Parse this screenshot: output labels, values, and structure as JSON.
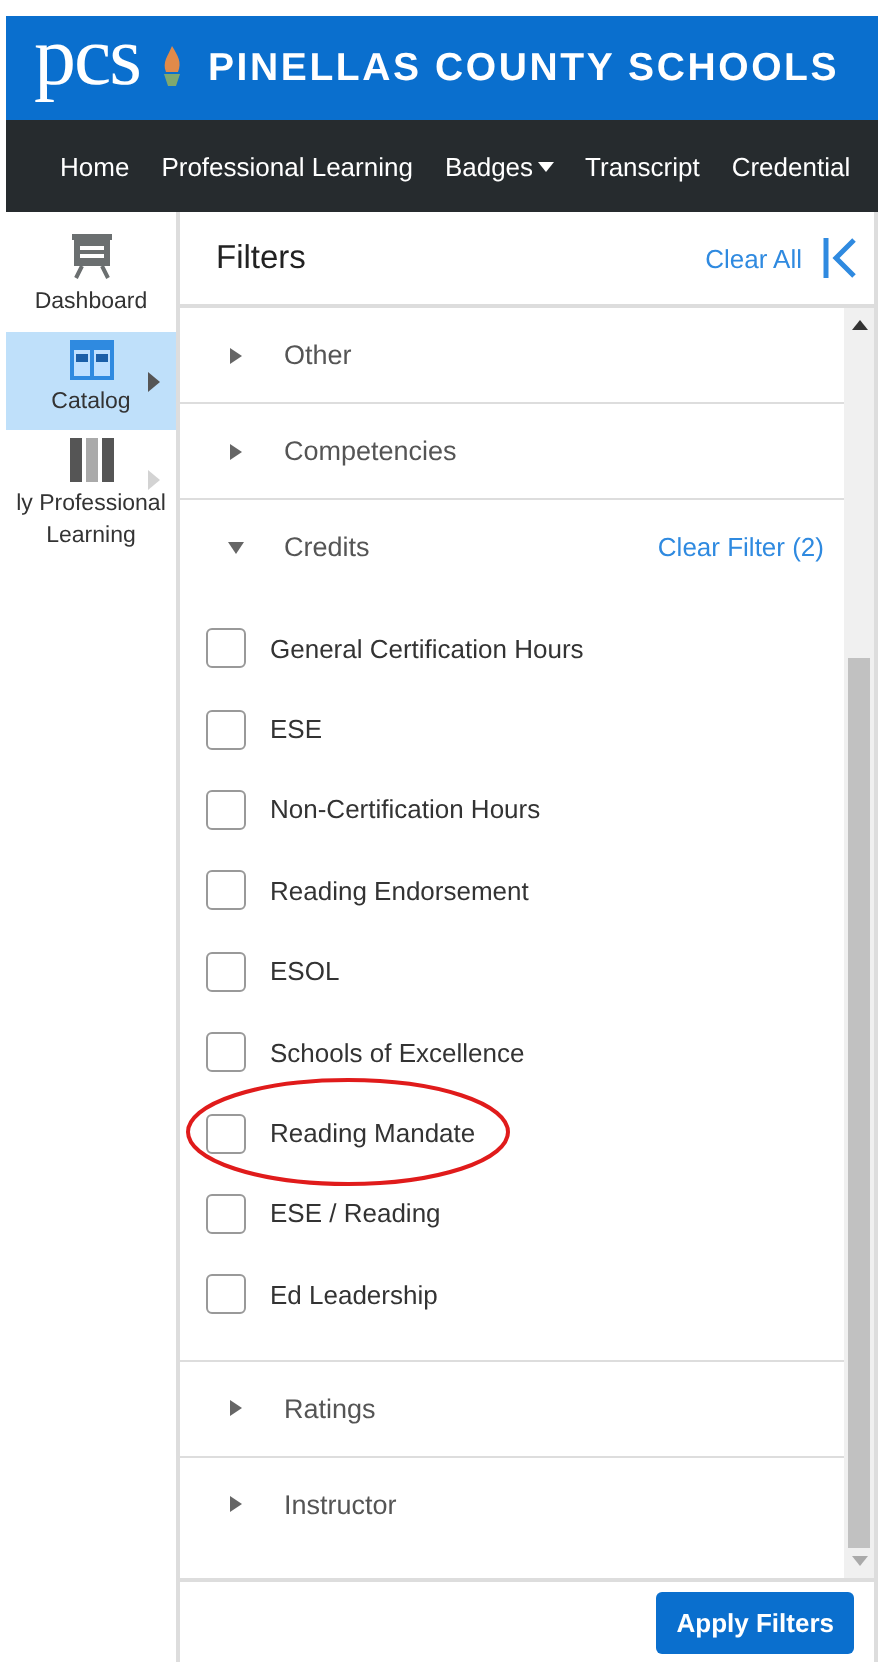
{
  "brand": {
    "logo": "pcs",
    "name": "PINELLAS COUNTY SCHOOLS"
  },
  "nav": [
    {
      "label": "Home",
      "dropdown": false
    },
    {
      "label": "Professional Learning",
      "dropdown": false
    },
    {
      "label": "Badges",
      "dropdown": true
    },
    {
      "label": "Transcript",
      "dropdown": false
    },
    {
      "label": "Credential",
      "dropdown": false
    }
  ],
  "sidebar": {
    "items": [
      {
        "kind": "dashboard",
        "selected": false,
        "arrow": false,
        "lines": [
          "Dashboard"
        ]
      },
      {
        "kind": "catalog",
        "selected": true,
        "arrow": true,
        "lines": [
          "Catalog"
        ]
      },
      {
        "kind": "learning",
        "selected": false,
        "arrow": true,
        "lines": [
          "ly Professional",
          "Learning"
        ]
      }
    ]
  },
  "filters": {
    "title": "Filters",
    "clear_all": "Clear All",
    "sections": [
      {
        "label": "Other",
        "expanded": false
      },
      {
        "label": "Competencies",
        "expanded": false
      },
      {
        "label": "Credits",
        "expanded": true,
        "clear_filter": "Clear Filter (2)",
        "options": [
          {
            "label": "General Certification Hours",
            "checked": false,
            "circled": false
          },
          {
            "label": "ESE",
            "checked": false,
            "circled": false
          },
          {
            "label": "Non-Certification Hours",
            "checked": false,
            "circled": false
          },
          {
            "label": "Reading Endorsement",
            "checked": false,
            "circled": false
          },
          {
            "label": "ESOL",
            "checked": false,
            "circled": false
          },
          {
            "label": "Schools of Excellence",
            "checked": false,
            "circled": false
          },
          {
            "label": "Reading Mandate",
            "checked": false,
            "circled": true
          },
          {
            "label": "ESE / Reading",
            "checked": false,
            "circled": false
          },
          {
            "label": "Ed Leadership",
            "checked": false,
            "circled": false
          }
        ]
      },
      {
        "label": "Ratings",
        "expanded": false
      },
      {
        "label": "Instructor",
        "expanded": false
      }
    ],
    "apply": "Apply Filters"
  }
}
